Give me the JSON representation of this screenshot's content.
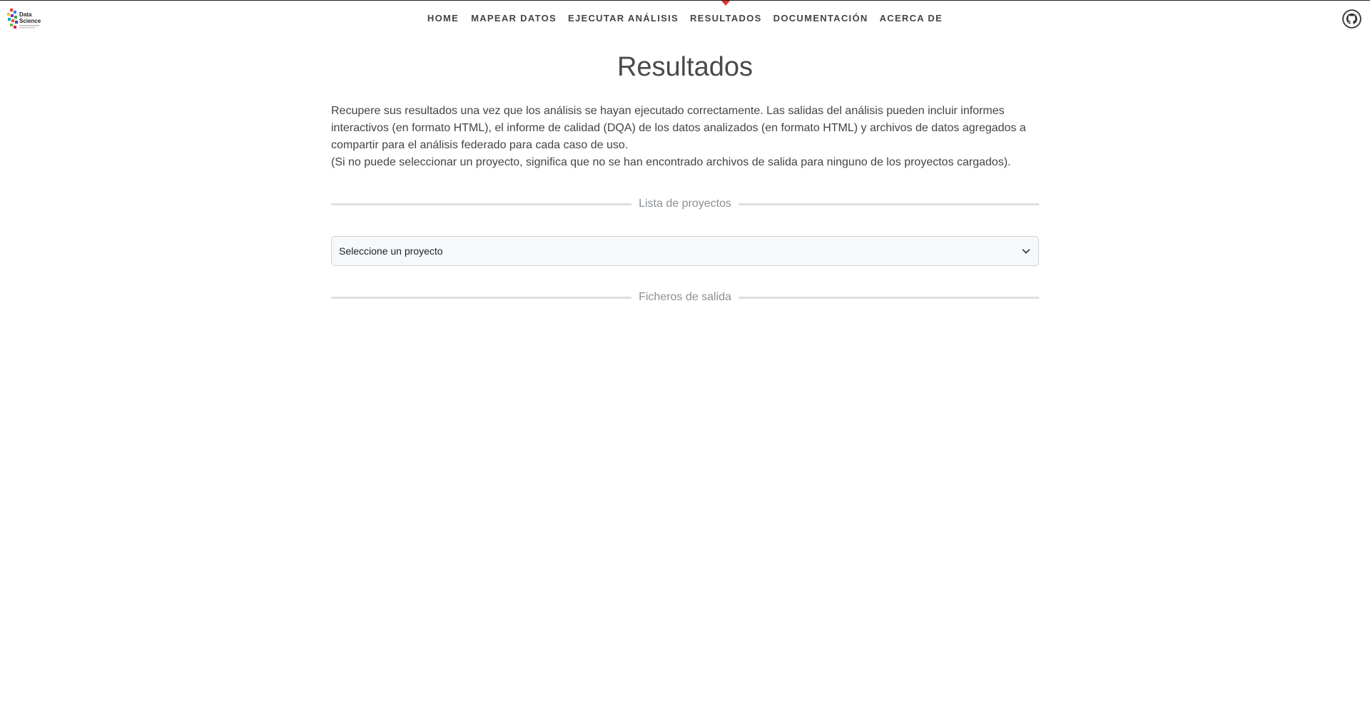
{
  "brand": {
    "logo_text_line1": "Data",
    "logo_text_line2": "Science",
    "logo_icon": "data-science-logo"
  },
  "nav": {
    "items": [
      {
        "label": "HOME",
        "active": false
      },
      {
        "label": "MAPEAR DATOS",
        "active": false
      },
      {
        "label": "EJECUTAR ANÁLISIS",
        "active": false
      },
      {
        "label": "RESULTADOS",
        "active": true
      },
      {
        "label": "DOCUMENTACIÓN",
        "active": false
      },
      {
        "label": "ACERCA DE",
        "active": false
      }
    ],
    "active_marker_color": "#e5322d",
    "github_icon": "github-icon"
  },
  "main": {
    "title": "Resultados",
    "description_1": "Recupere sus resultados una vez que los análisis se hayan ejecutado correctamente. Las salidas del análisis pueden incluir informes interactivos (en formato HTML), el informe de calidad (DQA) de los datos analizados (en formato HTML) y archivos de datos agregados a compartir para el análisis federado para cada caso de uso.",
    "description_2": "(Si no puede seleccionar un proyecto, significa que no se han encontrado archivos de salida para ninguno de los proyectos cargados).",
    "projects_divider": "Lista de proyectos",
    "project_select": {
      "selected": "Seleccione un proyecto",
      "icon": "chevron-down-icon"
    },
    "outputs_divider": "Ficheros de salida"
  }
}
